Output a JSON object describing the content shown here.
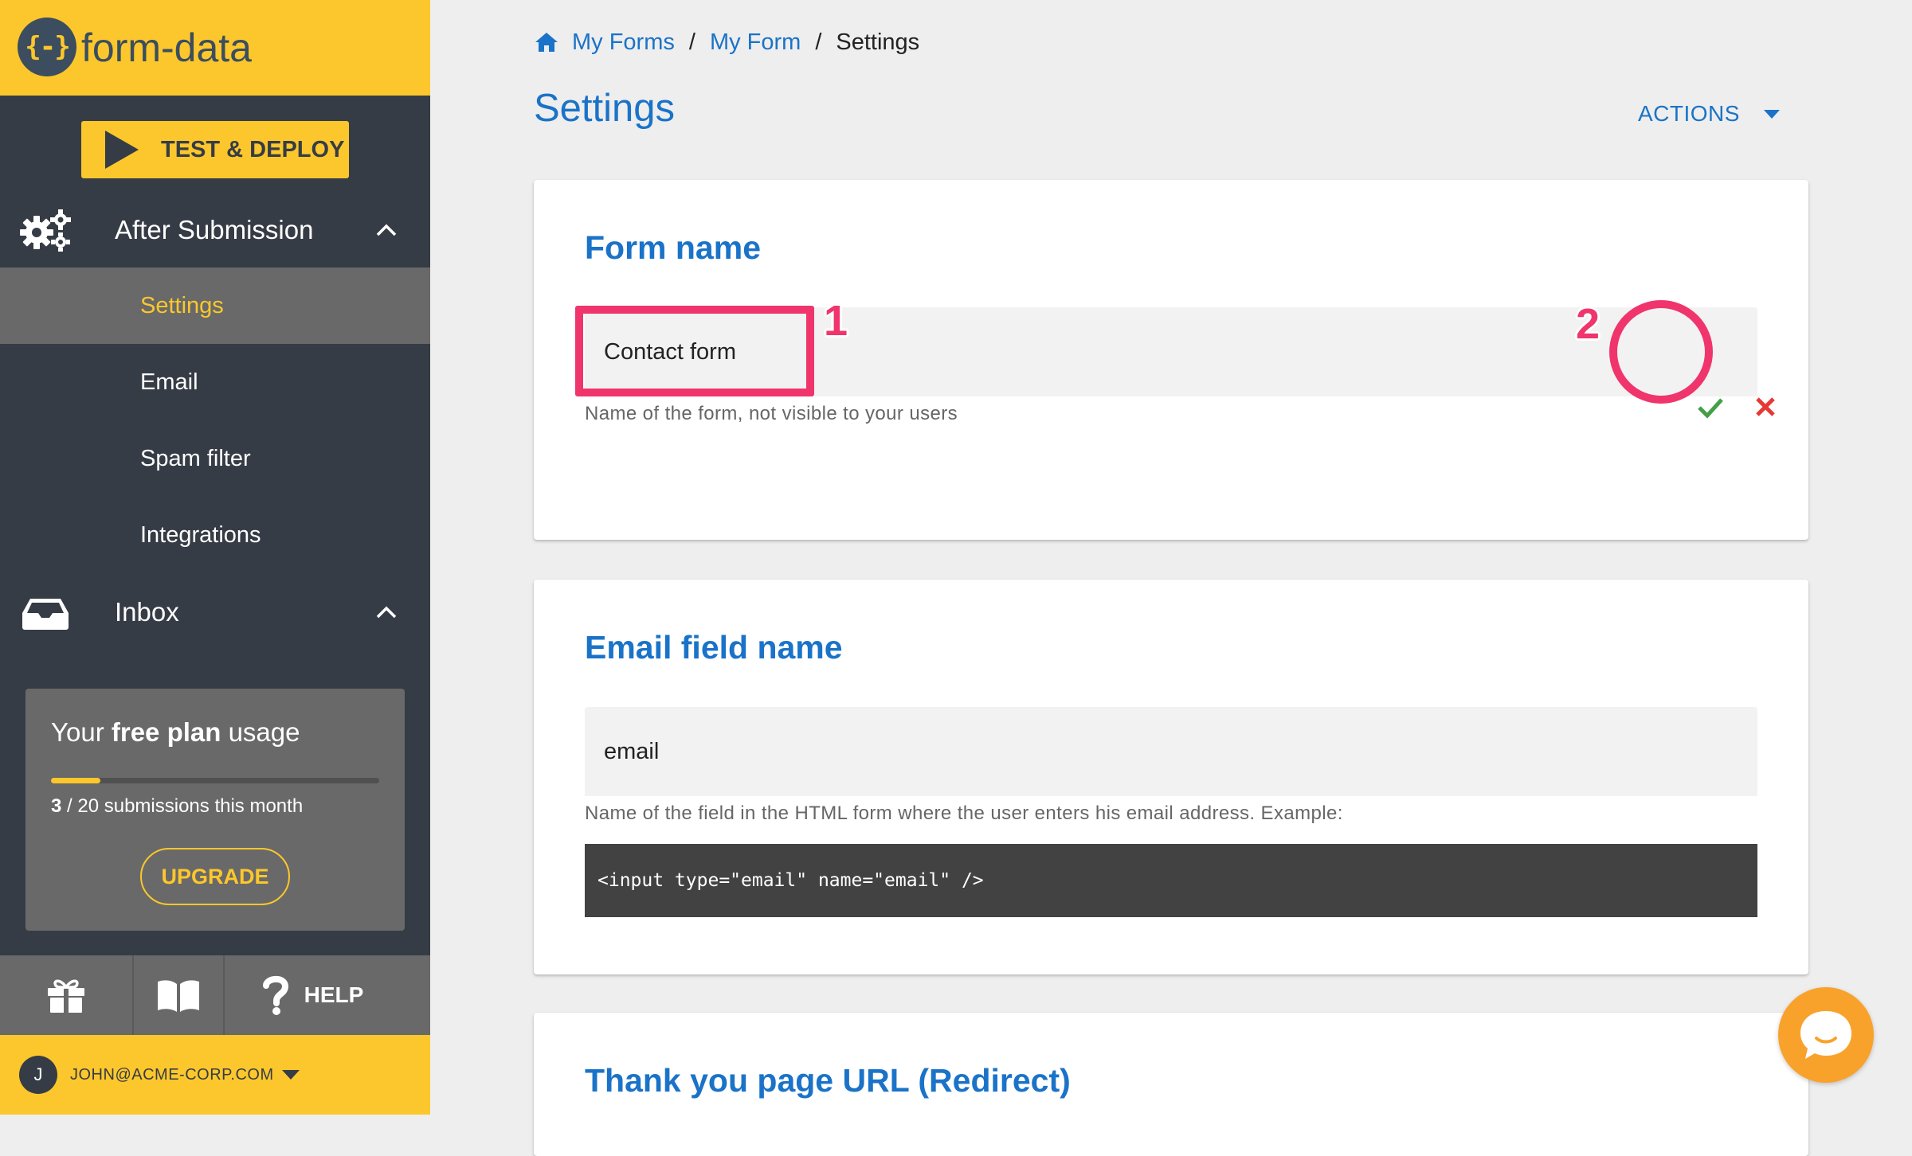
{
  "app": {
    "logo_mark": "{-}",
    "logo_text": "form-data"
  },
  "sidebar": {
    "deploy_label": "TEST & DEPLOY",
    "groups": [
      {
        "label": "After Submission",
        "icon": "gears-icon",
        "expanded": true
      },
      {
        "label": "Inbox",
        "icon": "inbox-icon",
        "expanded": true
      }
    ],
    "items": [
      {
        "label": "Settings",
        "active": true
      },
      {
        "label": "Email",
        "active": false
      },
      {
        "label": "Spam filter",
        "active": false
      },
      {
        "label": "Integrations",
        "active": false
      }
    ],
    "usage": {
      "title_prefix": "Your",
      "title_bold": "free plan",
      "title_suffix": "usage",
      "used": "3",
      "limit_text": "/ 20 submissions this month",
      "progress_fraction": 0.15,
      "upgrade_label": "UPGRADE"
    },
    "bottom": {
      "help_label": "HELP"
    },
    "user": {
      "initial": "J",
      "email": "JOHN@ACME-CORP.COM"
    }
  },
  "breadcrumb": {
    "items": [
      "My Forms",
      "My Form"
    ],
    "separator": "/",
    "current": "Settings"
  },
  "page": {
    "title": "Settings",
    "actions_label": "ACTIONS"
  },
  "cards": {
    "form_name": {
      "title": "Form name",
      "value": "Contact form",
      "hint": "Name of the form, not visible to your users"
    },
    "email_field": {
      "title": "Email field name",
      "value": "email",
      "hint": "Name of the field in the HTML form where the user enters his email address. Example:",
      "code": "<input type=\"email\" name=\"email\" />"
    },
    "thank_you": {
      "title": "Thank you page URL (Redirect)"
    }
  },
  "annotations": {
    "one": "1",
    "two": "2"
  },
  "colors": {
    "brand_yellow": "#fcc72c",
    "sidebar_dark": "#363c45",
    "accent_blue": "#1a73c8",
    "annotation_pink": "#f0356c",
    "confirm_green": "#43a047",
    "cancel_red": "#e53935",
    "chat_orange": "#f9a22b"
  }
}
